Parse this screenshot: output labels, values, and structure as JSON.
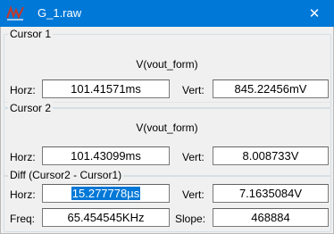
{
  "window": {
    "title": "G_1.raw",
    "close_glyph": "✕"
  },
  "cursor1": {
    "legend": "Cursor 1",
    "trace": "V(vout_form)",
    "horz_label": "Horz:",
    "horz_value": "101.41571ms",
    "vert_label": "Vert:",
    "vert_value": "845.22456mV"
  },
  "cursor2": {
    "legend": "Cursor 2",
    "trace": "V(vout_form)",
    "horz_label": "Horz:",
    "horz_value": "101.43099ms",
    "vert_label": "Vert:",
    "vert_value": "8.008733V"
  },
  "diff": {
    "legend": "Diff (Cursor2 - Cursor1)",
    "horz_label": "Horz:",
    "horz_value": "15.277778µs",
    "vert_label": "Vert:",
    "vert_value": "7.1635084V",
    "freq_label": "Freq:",
    "freq_value": "65.454545KHz",
    "slope_label": "Slope:",
    "slope_value": "468884"
  },
  "colors": {
    "titlebar": "#0078d7",
    "selection": "#0078d7",
    "app_icon": "#c0392b"
  },
  "icons": {
    "app": "waveform-app-icon",
    "close": "close-icon"
  }
}
